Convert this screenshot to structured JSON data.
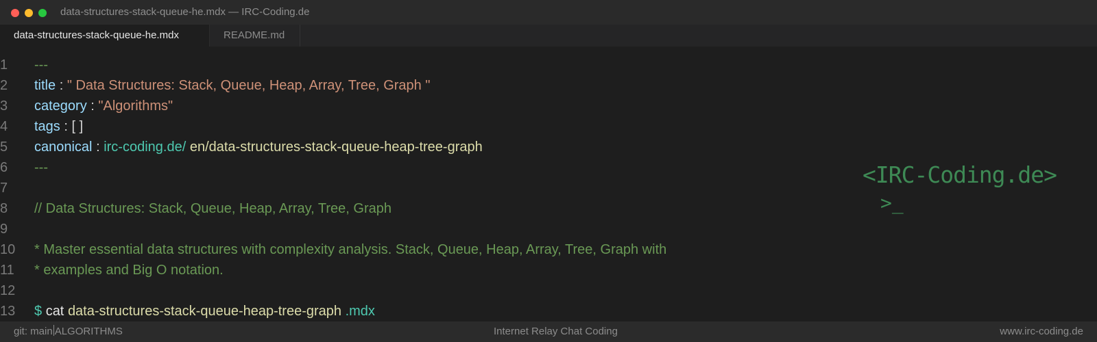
{
  "window": {
    "title": "data-structures-stack-queue-he.mdx — IRC-Coding.de"
  },
  "tabs": [
    {
      "label": "data-structures-stack-queue-he.mdx",
      "active": true
    },
    {
      "label": "README.md",
      "active": false
    }
  ],
  "editor": {
    "line_numbers": [
      "1",
      "2",
      "3",
      "4",
      "5",
      "6",
      "7",
      "8",
      "9",
      "10",
      "11",
      "12",
      "13"
    ],
    "frontmatter_delimiter": "---",
    "title_key": "title",
    "title_value": "\" Data Structures: Stack, Queue, Heap, Array, Tree, Graph \"",
    "category_key": "category",
    "category_value": "\"Algorithms\"",
    "tags_key": "tags",
    "tags_value": "[ ]",
    "canonical_key": "canonical",
    "canonical_domain": "irc-coding.de/",
    "canonical_path": "en/data-structures-stack-queue-heap-tree-graph",
    "separator": ":",
    "comment_line": "// Data Structures: Stack, Queue, Heap, Array, Tree, Graph",
    "desc_line_1": "* Master essential data structures with complexity analysis. Stack, Queue, Heap, Array, Tree, Graph with",
    "desc_line_2": "* examples and Big O notation.",
    "prompt_symbol": "$",
    "command": "cat",
    "command_file": "data-structures-stack-queue-heap-tree-graph",
    "command_ext": ".mdx"
  },
  "logo": {
    "text": "<IRC-Coding.de>",
    "cursor": ">_"
  },
  "statusbar": {
    "branch": "git: main",
    "section": "ALGORITHMS",
    "center": "Internet Relay Chat Coding",
    "right": "www.irc-coding.de"
  },
  "colors": {
    "background": "#1e1e1e",
    "logo_green": "#3e8a55",
    "comment_green": "#6a9955",
    "string_orange": "#ce9178",
    "key_blue": "#9cdcfe",
    "url_teal": "#4ec9b0"
  }
}
